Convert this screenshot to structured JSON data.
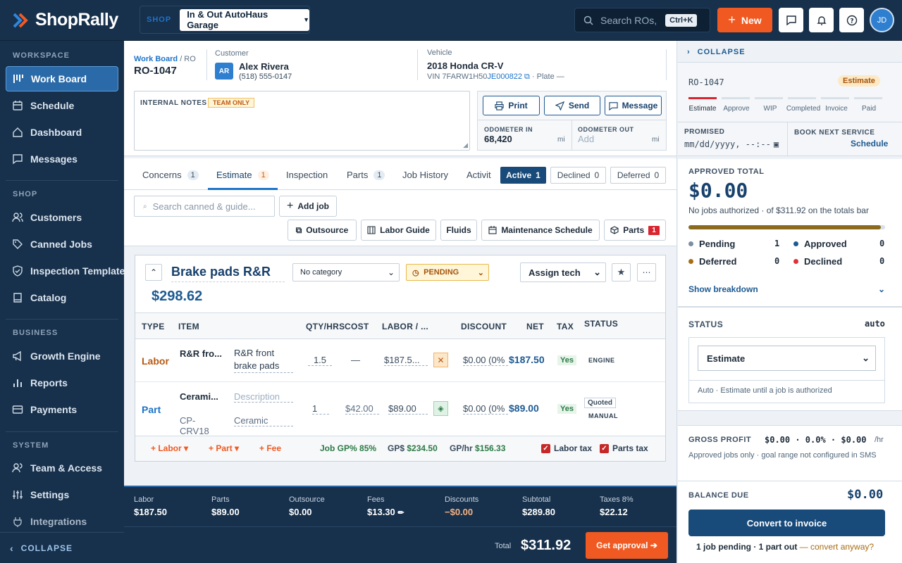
{
  "app": {
    "name": "ShopRally"
  },
  "topbar": {
    "shop_label": "SHOP",
    "shop_name": "In & Out AutoHaus Garage",
    "search_placeholder": "Search ROs,",
    "search_shortcut": "Ctrl+K",
    "new_label": "New",
    "avatar_initials": "JD"
  },
  "sidebar": {
    "sections": {
      "workspace": "WORKSPACE",
      "shop": "SHOP",
      "business": "BUSINESS",
      "system": "SYSTEM"
    },
    "items": [
      {
        "label": "Work Board"
      },
      {
        "label": "Schedule"
      },
      {
        "label": "Dashboard"
      },
      {
        "label": "Messages"
      },
      {
        "label": "Customers"
      },
      {
        "label": "Canned Jobs"
      },
      {
        "label": "Inspection Templates"
      },
      {
        "label": "Catalog"
      },
      {
        "label": "Growth Engine"
      },
      {
        "label": "Reports"
      },
      {
        "label": "Payments"
      },
      {
        "label": "Team & Access"
      },
      {
        "label": "Settings"
      },
      {
        "label": "Integrations"
      }
    ],
    "collapse_label": "COLLAPSE"
  },
  "ro": {
    "breadcrumb_link": "Work Board",
    "breadcrumb_sep": " / RO",
    "number": "RO-1047",
    "customer_label": "Customer",
    "customer_initials": "AR",
    "customer_name": "Alex Rivera",
    "customer_phone": "(518) 555-0147",
    "vehicle_label": "Vehicle",
    "vehicle_name": "2018 Honda CR-V",
    "vin_prefix": "VIN 7FARW1H50",
    "vin_suffix": "JE000822",
    "plate": "· Plate —"
  },
  "notes": {
    "label": "INTERNAL NOTES",
    "badge": "TEAM ONLY"
  },
  "actions": {
    "print": "Print",
    "send": "Send",
    "message": "Message"
  },
  "odometer": {
    "in_label": "ODOMETER IN",
    "in_value": "68,420",
    "in_unit": "mi",
    "out_label": "ODOMETER OUT",
    "out_placeholder": "Add",
    "out_unit": "mi"
  },
  "tabs": [
    {
      "label": "Concerns",
      "count": "1"
    },
    {
      "label": "Estimate",
      "count": "1"
    },
    {
      "label": "Inspection",
      "count": ""
    },
    {
      "label": "Parts",
      "count": "1"
    },
    {
      "label": "Job History",
      "count": ""
    },
    {
      "label": "Activit",
      "count": ""
    }
  ],
  "filters": [
    {
      "label": "Active",
      "count": "1"
    },
    {
      "label": "Declined",
      "count": "0"
    },
    {
      "label": "Deferred",
      "count": "0"
    }
  ],
  "toolbar": {
    "search_placeholder": "Search canned & guide...",
    "add_job": "Add job",
    "outsource": "Outsource",
    "labor_guide": "Labor Guide",
    "fluids": "Fluids",
    "maintenance": "Maintenance Schedule",
    "parts": "Parts",
    "parts_count": "1"
  },
  "job": {
    "title": "Brake pads R&R",
    "category": "No category",
    "status": "PENDING",
    "assign": "Assign tech",
    "total": "$298.62",
    "columns": [
      "TYPE",
      "ITEM",
      "QTY/HRS",
      "COST",
      "LABOR / ...",
      "DISCOUNT",
      "NET",
      "TAX",
      "STATUS"
    ],
    "rows": [
      {
        "type": "Labor",
        "name": "R&R fro...",
        "desc": "R&R front brake pads",
        "qty": "1.5",
        "cost": "—",
        "price": "$187.5...",
        "discount": "$0.00 (0%",
        "net": "$187.50",
        "tax": "Yes",
        "status": "ENGINE",
        "status2": ""
      },
      {
        "type": "Part",
        "name": "Cerami...",
        "part_no": "CP-CRV18",
        "desc_placeholder": "Description",
        "desc": "Ceramic",
        "qty": "1",
        "cost": "$42.00",
        "price": "$89.00",
        "discount": "$0.00 (0%",
        "net": "$89.00",
        "tax": "Yes",
        "status": "Quoted",
        "status2": "MANUAL"
      }
    ],
    "add_labor": "+ Labor ▾",
    "add_part": "+ Part ▾",
    "add_fee": "+ Fee",
    "gp_label": "Job GP%",
    "gp_value": "85%",
    "gpd_label": "GP$",
    "gpd_value": "$234.50",
    "gph_label": "GP/hr",
    "gph_value": "$156.33",
    "labor_tax": "Labor tax",
    "parts_tax": "Parts tax"
  },
  "totals": {
    "labor_label": "Labor",
    "labor": "$187.50",
    "parts_label": "Parts",
    "parts": "$89.00",
    "outsource_label": "Outsource",
    "outsource": "$0.00",
    "fees_label": "Fees",
    "fees": "$13.30",
    "discounts_label": "Discounts",
    "discounts": "−$0.00",
    "subtotal_label": "Subtotal",
    "subtotal": "$289.80",
    "taxes_label": "Taxes 8%",
    "taxes": "$22.12",
    "total_label": "Total",
    "total": "$311.92",
    "approval": "Get approval ➔"
  },
  "right": {
    "collapse": "COLLAPSE",
    "ro_number": "RO-1047",
    "stage_badge": "Estimate",
    "stages": [
      "Estimate",
      "Approve",
      "WIP",
      "Completed",
      "Invoice",
      "Paid"
    ],
    "promised_label": "PROMISED",
    "promised_placeholder": "mm/dd/yyyy, --:--",
    "book_label": "BOOK NEXT SERVICE",
    "book_link": "Schedule",
    "approved_label": "APPROVED TOTAL",
    "approved_value": "$0.00",
    "approved_note": "No jobs authorized · of $311.92 on the totals bar",
    "progress_fraction": 0.98,
    "legend": [
      {
        "label": "Pending",
        "count": "1",
        "color": "#7b8fa3"
      },
      {
        "label": "Approved",
        "count": "0",
        "color": "#1d5a92"
      },
      {
        "label": "Deferred",
        "count": "0",
        "color": "#a86d13"
      },
      {
        "label": "Declined",
        "count": "0",
        "color": "#e0303c"
      }
    ],
    "breakdown": "Show breakdown",
    "status_label": "STATUS",
    "status_mode": "auto",
    "status_value": "Estimate",
    "status_note": "Auto · Estimate until a job is authorized",
    "gross_label": "GROSS PROFIT",
    "gross_value": "$0.00 · 0.0% · $0.00",
    "gross_unit": "/hr",
    "gross_note": "Approved jobs only · goal range not configured in SMS",
    "balance_label": "BALANCE DUE",
    "balance_value": "$0.00",
    "convert": "Convert to invoice",
    "pending_note": "1 job pending · 1 part out",
    "convert_anyway": "— convert anyway?"
  },
  "colors": {
    "accent": "#f05a22",
    "navy": "#17304b",
    "primary": "#1d5a92"
  }
}
